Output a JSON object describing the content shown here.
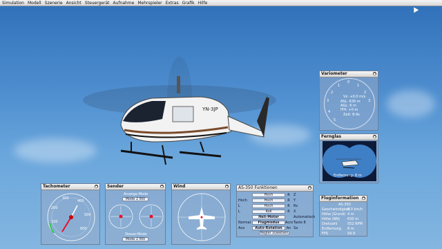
{
  "menu": [
    "Simulation",
    "Modell",
    "Szenerie",
    "Ansicht",
    "Steuergerät",
    "Aufnahme",
    "Mehrspieler",
    "Extras",
    "Grafik",
    "Hilfe"
  ],
  "helicopter": {
    "registration": "YN-3JP"
  },
  "variometer": {
    "title": "Variometer",
    "scale_top": [
      "0",
      "1",
      "2",
      "3"
    ],
    "scale_left": [
      "0",
      "1",
      "2",
      "3",
      "4",
      "5"
    ],
    "vz": "Vz: +0.0 m/s",
    "asl": "ASL: 630 m",
    "agl": "AGL: 6 m",
    "ifh": "IFH: +0 m",
    "time": "Zeit: 8:4s"
  },
  "fernglas": {
    "title": "Fernglas",
    "distance": "Entfernung: 8 m"
  },
  "tachometer": {
    "title": "Tachometer",
    "ticks": [
      "100",
      "200",
      "300",
      "400",
      "500",
      "600"
    ]
  },
  "sender": {
    "title": "Sender",
    "mode_top_label": "Anzeige-Mode",
    "mode_top_value": "Mode 2 INV",
    "mode_bottom_label": "Steuer-Mode",
    "mode_bottom_value": "Mode 2 INV"
  },
  "wind": {
    "title": "Wind"
  },
  "funktionen": {
    "title": "AS-350 Funktionen",
    "rows": [
      {
        "left": "",
        "mid": "Hoch",
        "r": "R",
        "right": "Z"
      },
      {
        "left": "Hoch",
        "mid": "Hoch",
        "r": "R",
        "right": "Y"
      },
      {
        "left": "L",
        "mid": "Hoch",
        "r": "R",
        "right": "Rz"
      },
      {
        "left": "L",
        "mid": "Roll",
        "r": "R",
        "right": "X"
      },
      {
        "left": "",
        "mid": "Heli-Motor",
        "r": "",
        "right": "Automatisch"
      },
      {
        "left": "Normal",
        "mid": "Flugmodus",
        "r": "Acro",
        "right": "Taste 8"
      },
      {
        "left": "Aus",
        "mid": "Auto-Rotation",
        "r": "An",
        "right": "Sa"
      }
    ],
    "button": "Regler zuweisen"
  },
  "fluginfo": {
    "title": "Fluginformation",
    "model": "AS-350",
    "rows": [
      {
        "label": "Geschwindigkeit",
        "value": "0.0 km/h"
      },
      {
        "label": "Höhe (Grund)",
        "value": "4 m"
      },
      {
        "label": "Höhe (NN)",
        "value": "630 m"
      },
      {
        "label": "Drehzahl",
        "value": "552 RPM"
      },
      {
        "label": "Entfernung",
        "value": "8 m"
      },
      {
        "label": "FPS",
        "value": "59.9"
      }
    ]
  },
  "colors": {
    "sky_top": "#2f6fb8",
    "sky_bottom": "#84b6e0",
    "needle": "#e8102a"
  }
}
